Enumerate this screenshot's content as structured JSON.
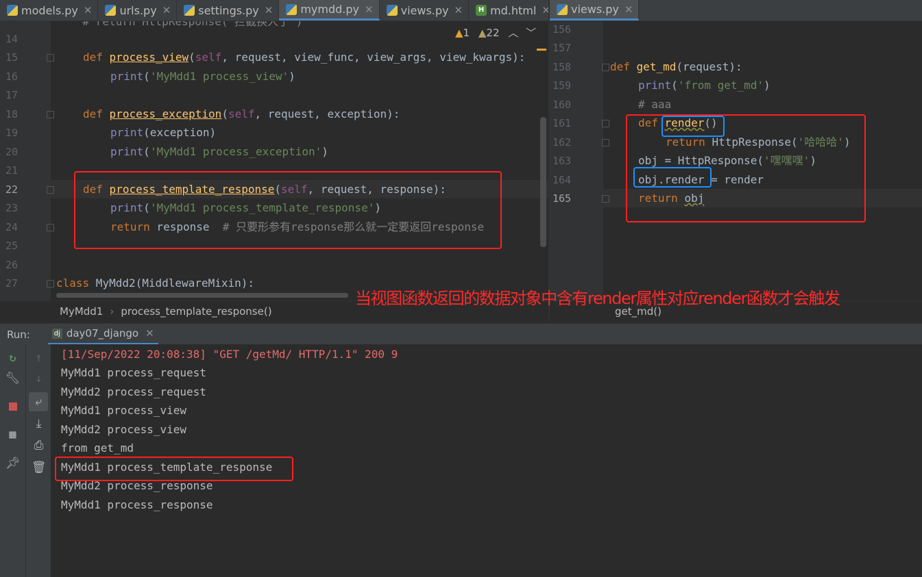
{
  "tabs_left": [
    {
      "label": "models.py",
      "type": "py"
    },
    {
      "label": "urls.py",
      "type": "py"
    },
    {
      "label": "settings.py",
      "type": "py"
    },
    {
      "label": "mymdd.py",
      "type": "py",
      "active": true
    },
    {
      "label": "views.py",
      "type": "py"
    },
    {
      "label": "md.html",
      "type": "html"
    }
  ],
  "tabs_right": [
    {
      "label": "views.py",
      "type": "py",
      "active": true
    }
  ],
  "inspections": {
    "errors": "1",
    "warnings": "22"
  },
  "left_editor": {
    "top_partial": "    # return HttpResponse('拦截换人了')",
    "lines": [
      "14",
      "15",
      "16",
      "17",
      "18",
      "19",
      "20",
      "21",
      "22",
      "23",
      "24",
      "25",
      "26",
      "27"
    ],
    "breadcrumb": [
      "MyMdd1",
      "process_template_response()"
    ]
  },
  "right_editor": {
    "lines": [
      "156",
      "157",
      "158",
      "159",
      "160",
      "161",
      "162",
      "163",
      "164",
      "165"
    ],
    "breadcrumb": "get_md()"
  },
  "code": {
    "def": "def",
    "self": "self",
    "print": "print",
    "return": "return",
    "class": "class",
    "process_view": "process_view",
    "process_view_params": ", request, view_func, view_args, view_kwargs):",
    "s_view": "'MyMdd1 process_view'",
    "process_exception": "process_exception",
    "process_exception_params": ", request, exception):",
    "print_exception": "(exception)",
    "s_exc": "'MyMdd1 process_exception'",
    "process_template_response": "process_template_response",
    "ptr_params": ", request, response):",
    "s_ptr": "'MyMdd1 process_template_response'",
    "ret_resp": " response  ",
    "comment_ptr": "# 只要形参有response那么就一定要返回response",
    "class_line": " MyMdd2(MiddlewareMixin):",
    "get_md": "get_md",
    "get_md_params": "(request):",
    "s_from": "'from get_md'",
    "comment_aaa": "# aaa",
    "render": "render",
    "render_parens": "()",
    "http_resp": "HttpResponse",
    "s_haha": "'哈哈哈'",
    "obj_assign": "obj = HttpResponse(",
    "s_heihei": "'嘿嘿嘿'",
    "obj": "obj",
    ".render": ".render",
    " = render": " = render"
  },
  "annotation": "当视图函数返回的数据对象中含有render属性对应render函数才会触发",
  "run": {
    "label": "Run:",
    "config": "day07_django"
  },
  "console": [
    {
      "text": "[11/Sep/2022 20:08:38] \"GET /getMd/ HTTP/1.1\" 200 9",
      "color": "#e86a6a"
    },
    {
      "text": "MyMdd1 process_request"
    },
    {
      "text": "MyMdd2 process_request"
    },
    {
      "text": "MyMdd1 process_view"
    },
    {
      "text": "MyMdd2 process_view"
    },
    {
      "text": "from get_md"
    },
    {
      "text": "MyMdd1 process_template_response"
    },
    {
      "text": "MyMdd2 process_response"
    },
    {
      "text": "MyMdd1 process_response"
    }
  ]
}
